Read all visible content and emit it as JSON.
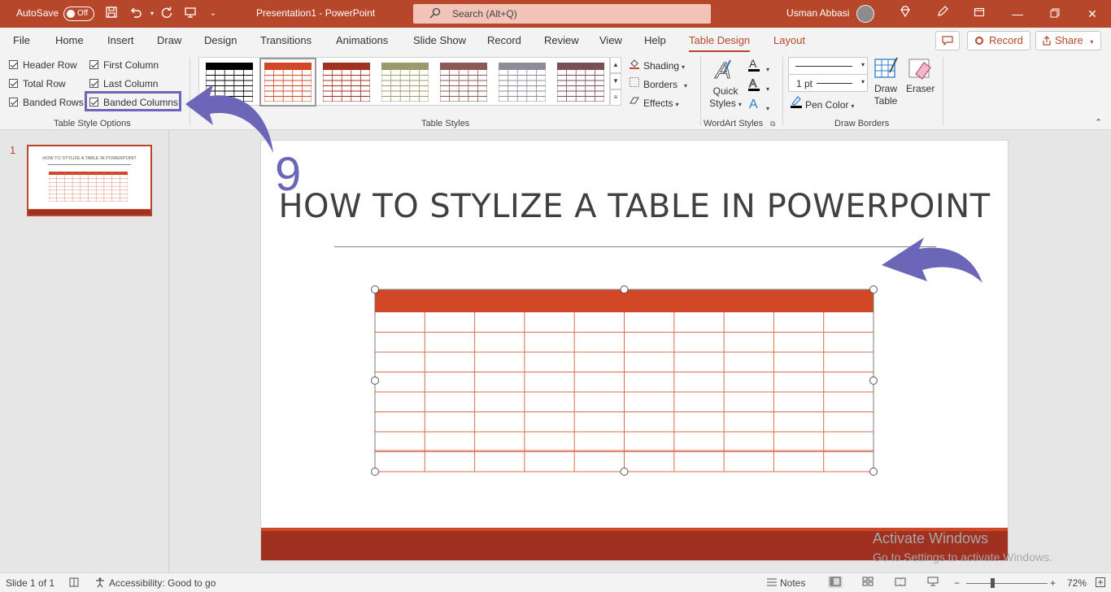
{
  "titlebar": {
    "autosave_label": "AutoSave",
    "autosave_state": "Off",
    "doc_title": "Presentation1  -  PowerPoint",
    "search_placeholder": "Search (Alt+Q)",
    "user_name": "Usman Abbasi",
    "background_color": "#b7472a"
  },
  "tabs": [
    {
      "label": "File"
    },
    {
      "label": "Home"
    },
    {
      "label": "Insert"
    },
    {
      "label": "Draw"
    },
    {
      "label": "Design"
    },
    {
      "label": "Transitions"
    },
    {
      "label": "Animations"
    },
    {
      "label": "Slide Show"
    },
    {
      "label": "Record"
    },
    {
      "label": "Review"
    },
    {
      "label": "View"
    },
    {
      "label": "Help"
    },
    {
      "label": "Table Design",
      "active": true
    },
    {
      "label": "Layout",
      "contextual": true
    }
  ],
  "top_buttons": {
    "record": "Record",
    "share": "Share"
  },
  "table_style_options": {
    "group_label": "Table Style Options",
    "checkboxes": [
      {
        "label": "Header Row",
        "checked": true
      },
      {
        "label": "First Column",
        "checked": true
      },
      {
        "label": "Total Row",
        "checked": true
      },
      {
        "label": "Last Column",
        "checked": true
      },
      {
        "label": "Banded Rows",
        "checked": true
      },
      {
        "label": "Banded Columns",
        "checked": true
      }
    ]
  },
  "table_styles": {
    "group_label": "Table Styles",
    "swatches": [
      "#000000",
      "#d24726",
      "#a0301f",
      "#9c9a6b",
      "#8a5a52",
      "#8c8c9a",
      "#7a4e55"
    ],
    "selected_index": 1,
    "shading": "Shading",
    "borders": "Borders",
    "effects": "Effects"
  },
  "wordart_styles": {
    "group_label": "WordArt Styles",
    "quick_styles_1": "Quick",
    "quick_styles_2": "Styles"
  },
  "draw_borders": {
    "group_label": "Draw Borders",
    "pen_weight": "1 pt",
    "pen_color": "Pen Color",
    "draw_table_1": "Draw",
    "draw_table_2": "Table",
    "eraser": "Eraser"
  },
  "thumbnail": {
    "number": "1",
    "title": "HOW TO STYLIZE A TABLE IN POWERPOINT"
  },
  "slide": {
    "title": "HOW TO STYLIZE A TABLE IN POWERPOINT",
    "table_columns": 10,
    "table_rows": 8,
    "header_color": "#d24726",
    "line_color": "#d86d4e",
    "footer_color": "#a0301f"
  },
  "annotations": {
    "step_number": "9",
    "arrow_color": "#6b66b8"
  },
  "watermark": {
    "line1": "Activate Windows",
    "line2": "Go to Settings to activate Windows."
  },
  "statusbar": {
    "slide_count": "Slide 1 of 1",
    "accessibility": "Accessibility: Good to go",
    "notes": "Notes",
    "zoom": "72%"
  }
}
